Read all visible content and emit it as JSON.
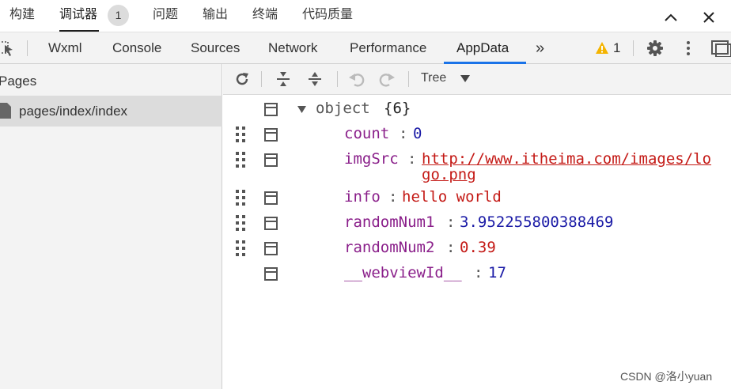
{
  "top_tabs": [
    {
      "label": "构建"
    },
    {
      "label": "调试器"
    },
    {
      "label": "问题"
    },
    {
      "label": "输出"
    },
    {
      "label": "终端"
    },
    {
      "label": "代码质量"
    }
  ],
  "top_badge": "1",
  "devtools_tabs": [
    {
      "label": "Wxml"
    },
    {
      "label": "Console"
    },
    {
      "label": "Sources"
    },
    {
      "label": "Network"
    },
    {
      "label": "Performance"
    },
    {
      "label": "AppData"
    }
  ],
  "more_tabs": "»",
  "warning_count": "1",
  "left_pane": {
    "title": "Pages",
    "items": [
      {
        "label": "pages/index/index"
      }
    ]
  },
  "sub_toolbar": {
    "view_mode": "Tree"
  },
  "tree": {
    "root_label": "object",
    "root_count": "{6}",
    "entries": [
      {
        "key": "count",
        "value": "0"
      },
      {
        "key": "imgSrc",
        "value_line1": "http://www.itheima.com/images/lo",
        "value_line2": "go.png"
      },
      {
        "key": "info",
        "value": "hello world"
      },
      {
        "key": "randomNum1",
        "value": "3.952255800388469"
      },
      {
        "key": "randomNum2",
        "value": "0.39"
      },
      {
        "key": "__webviewId__",
        "value": "17"
      }
    ]
  },
  "watermark": "CSDN @洛小yuan",
  "colors": {
    "accent": "#1a73e8",
    "key": "#8a1f8a",
    "number": "#1a1aa6",
    "string": "#c41a16",
    "warning": "#f4b400"
  }
}
